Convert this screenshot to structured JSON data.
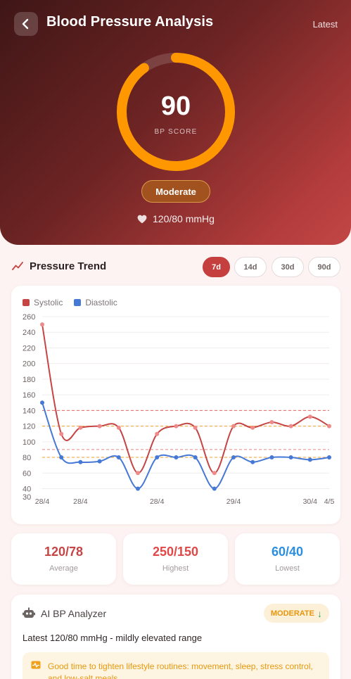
{
  "header": {
    "title": "Blood Pressure Analysis",
    "latest_label": "Latest",
    "icons": {
      "back": "chevron-left-icon",
      "heart": "heart-icon"
    }
  },
  "score": {
    "value": "90",
    "label": "BP SCORE",
    "gauge_fraction": 0.9,
    "status": "Moderate",
    "reading": "120/80 mmHg"
  },
  "trend": {
    "title": "Pressure Trend",
    "icon": "trend-line-icon",
    "ranges": [
      "7d",
      "14d",
      "30d",
      "90d"
    ],
    "active_range": "7d"
  },
  "chart_data": {
    "type": "line",
    "legend_placement": "top-left",
    "x": [
      "28/4",
      "",
      "28/4",
      "",
      "",
      "",
      "28/4",
      "",
      "",
      "",
      "29/4",
      "",
      "",
      "",
      "30/4",
      "4/5"
    ],
    "x_tick_labels": [
      "28/4",
      "28/4",
      "28/4",
      "29/4",
      "30/4",
      "4/5"
    ],
    "series": [
      {
        "name": "Systolic",
        "color": "#c54545",
        "values": [
          250,
          110,
          118,
          120,
          118,
          60,
          110,
          120,
          118,
          60,
          120,
          118,
          125,
          120,
          132,
          120
        ]
      },
      {
        "name": "Diastolic",
        "color": "#4678d6",
        "values": [
          150,
          80,
          74,
          75,
          80,
          40,
          80,
          80,
          80,
          40,
          80,
          74,
          80,
          80,
          77,
          80
        ]
      }
    ],
    "reference_lines": [
      {
        "value": 140,
        "color": "#e06a6a"
      },
      {
        "value": 120,
        "color": "#eea22a"
      },
      {
        "value": 90,
        "color": "#e88585"
      },
      {
        "value": 80,
        "color": "#eea22a"
      }
    ],
    "ylim": [
      30,
      260
    ],
    "y_ticks": [
      260,
      240,
      220,
      200,
      180,
      160,
      140,
      120,
      100,
      80,
      60,
      40,
      30
    ],
    "grid": true
  },
  "stats": [
    {
      "value": "120/78",
      "label": "Average",
      "color": "#c54545"
    },
    {
      "value": "250/150",
      "label": "Highest",
      "color": "#e04848"
    },
    {
      "value": "60/40",
      "label": "Lowest",
      "color": "#2c8ee0"
    }
  ],
  "ai": {
    "title": "AI BP Analyzer",
    "icon": "robot-icon",
    "badge": "MODERATE",
    "badge_arrow": "↓",
    "summary": "Latest 120/80 mmHg - mildly elevated range",
    "tip_icon": "activity-monitor-icon",
    "tip": "Good time to tighten lifestyle routines: movement, sleep, stress control, and low-salt meals."
  },
  "colors": {
    "accent": "#c53f3f",
    "gauge": "#ff9800",
    "moderate": "#e8960c"
  }
}
